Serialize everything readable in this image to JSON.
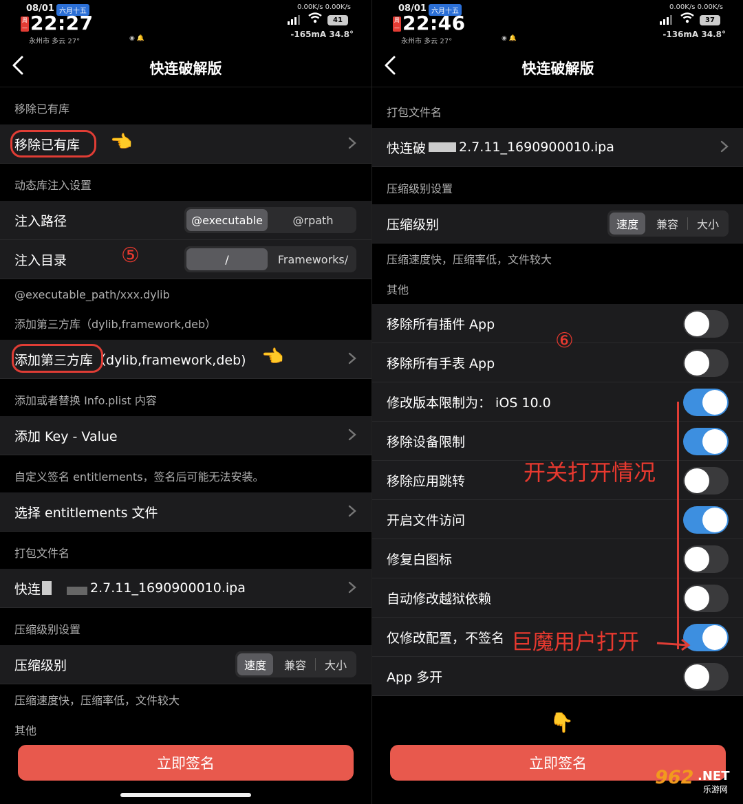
{
  "left": {
    "status": {
      "date": "08/01",
      "lunar": "六月十五",
      "time": "22:27",
      "weather": "永州市 多云  27°",
      "netspeed": "0.00K/s 0.00K/s",
      "battery": "41",
      "current": "-165mA 34.8°"
    },
    "title": "快连破解版",
    "sections": {
      "remove": {
        "header": "移除已有库",
        "row": "移除已有库"
      },
      "inject": {
        "header": "动态库注入设置",
        "path_label": "注入路径",
        "path_opt1": "@executable",
        "path_opt2": "@rpath",
        "dir_label": "注入目录",
        "dir_opt1": "/",
        "dir_opt2": "Frameworks/",
        "note": "@executable_path/xxx.dylib"
      },
      "third": {
        "header": "添加第三方库（dylib,framework,deb）",
        "row_a": "添加第三方库",
        "row_b": "（dylib,framework,deb)"
      },
      "plist": {
        "header": "添加或者替换 Info.plist 内容",
        "row": "添加 Key - Value"
      },
      "ent": {
        "header": "自定义签名 entitlements，签名后可能无法安装。",
        "row": "选择 entitlements 文件"
      },
      "pkg": {
        "header": "打包文件名",
        "row_a": "快连",
        "row_b": "2.7.11_1690900010.ipa"
      },
      "comp": {
        "header": "压缩级别设置",
        "row": "压缩级别",
        "opt1": "速度",
        "opt2": "兼容",
        "opt3": "大小",
        "note": "压缩速度快，压缩率低，文件较大"
      },
      "other": {
        "header": "其他"
      }
    },
    "annotation_5": "⑤",
    "sign_button": "立即签名"
  },
  "right": {
    "status": {
      "date": "08/01",
      "lunar": "六月十五",
      "time": "22:46",
      "weather": "永州市 多云  27°",
      "netspeed": "0.00K/s 0.00K/s",
      "battery": "37",
      "current": "-136mA 34.8°"
    },
    "title": "快连破解版",
    "pkg": {
      "header": "打包文件名",
      "row_a": "快连破",
      "row_b": "2.7.11_1690900010.ipa"
    },
    "comp": {
      "header": "压缩级别设置",
      "row": "压缩级别",
      "opt1": "速度",
      "opt2": "兼容",
      "opt3": "大小",
      "note": "压缩速度快，压缩率低，文件较大"
    },
    "other": {
      "header": "其他"
    },
    "toggles": [
      {
        "label": "移除所有插件 App",
        "on": false
      },
      {
        "label": "移除所有手表 App",
        "on": false
      },
      {
        "label": "修改版本限制为： iOS 10.0",
        "on": true
      },
      {
        "label": "移除设备限制",
        "on": true
      },
      {
        "label": "移除应用跳转",
        "on": false
      },
      {
        "label": "开启文件访问",
        "on": true
      },
      {
        "label": "修复白图标",
        "on": false
      },
      {
        "label": "自动修改越狱依赖",
        "on": false
      },
      {
        "label": "仅修改配置，不签名",
        "on": true
      },
      {
        "label": "App 多开",
        "on": false
      }
    ],
    "annotation_6": "⑥",
    "annotation_switch": "开关打开情况",
    "annotation_giant": "巨魔用户打开",
    "sign_button": "立即签名"
  },
  "watermark": {
    "num": "962",
    "net": ".NET",
    "sub": "乐游网"
  },
  "colors": {
    "accent_red": "#e8594d",
    "toggle_on": "#3d8fe0",
    "annotation": "#e03d35"
  }
}
